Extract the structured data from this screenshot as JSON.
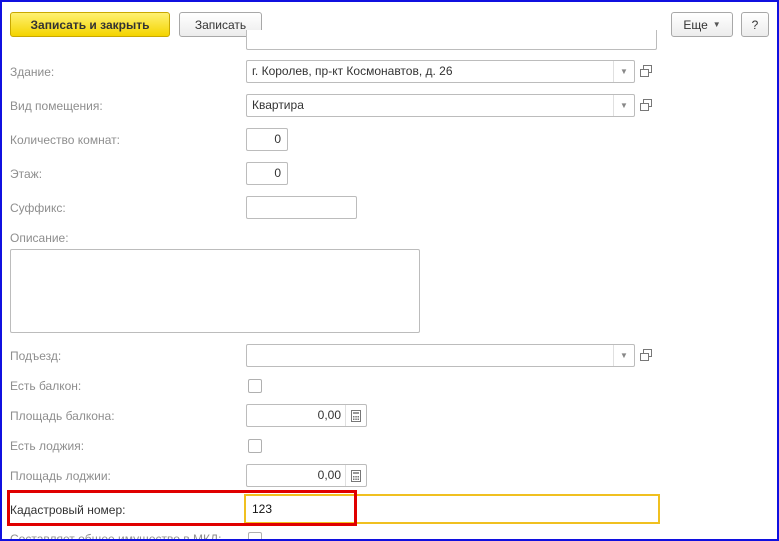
{
  "toolbar": {
    "save_close_label": "Записать и закрыть",
    "save_label": "Записать",
    "more_label": "Еще",
    "help_label": "?"
  },
  "fields": {
    "building": {
      "label": "Здание:",
      "value": "г. Королев, пр-кт Космонавтов, д. 26"
    },
    "room_type": {
      "label": "Вид помещения:",
      "value": "Квартира"
    },
    "room_count": {
      "label": "Количество комнат:",
      "value": "0"
    },
    "floor": {
      "label": "Этаж:",
      "value": "0"
    },
    "suffix": {
      "label": "Суффикс:",
      "value": ""
    },
    "description": {
      "label": "Описание:",
      "value": ""
    },
    "entrance": {
      "label": "Подъезд:",
      "value": ""
    },
    "has_balcony": {
      "label": "Есть балкон:",
      "checked": false
    },
    "balcony_area": {
      "label": "Площадь балкона:",
      "value": "0,00"
    },
    "has_loggia": {
      "label": "Есть лоджия:",
      "checked": false
    },
    "loggia_area": {
      "label": "Площадь лоджии:",
      "value": "0,00"
    },
    "cadastral_number": {
      "label": "Кадастровый номер:",
      "value": "123"
    },
    "common_property": {
      "label": "Составляет общее имущество в МКД:"
    }
  },
  "colors": {
    "primary_button": "#f4d400",
    "focus_border": "#f0c020",
    "highlight_frame": "#e00000",
    "window_border": "#1010e0"
  }
}
